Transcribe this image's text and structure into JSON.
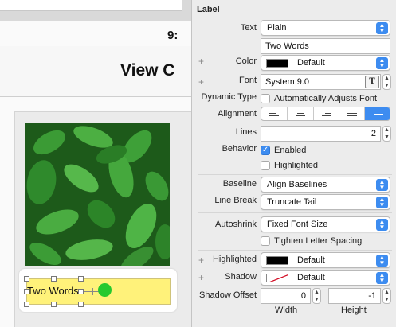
{
  "canvas": {
    "time": "9:",
    "view_title": "View C",
    "label_text": "Two Words"
  },
  "inspector": {
    "section_title": "Label",
    "text": {
      "label": "Text",
      "mode": "Plain",
      "value": "Two Words"
    },
    "color": {
      "label": "Color",
      "value": "Default",
      "swatch": "#000000"
    },
    "font": {
      "label": "Font",
      "value": "System 9.0",
      "icon": "font-T-icon"
    },
    "dynamic_type": {
      "label": "Dynamic Type",
      "checkbox": "Automatically Adjusts Font",
      "checked": false
    },
    "alignment": {
      "label": "Alignment",
      "options": [
        "left",
        "center",
        "right",
        "justified",
        "natural"
      ],
      "selected": "natural"
    },
    "lines": {
      "label": "Lines",
      "value": "2"
    },
    "behavior": {
      "label": "Behavior",
      "enabled": {
        "label": "Enabled",
        "checked": true
      },
      "highlighted": {
        "label": "Highlighted",
        "checked": false
      }
    },
    "baseline": {
      "label": "Baseline",
      "value": "Align Baselines"
    },
    "line_break": {
      "label": "Line Break",
      "value": "Truncate Tail"
    },
    "autoshrink": {
      "label": "Autoshrink",
      "value": "Fixed Font Size",
      "tighten": "Tighten Letter Spacing",
      "tighten_checked": false
    },
    "highlighted_color": {
      "label": "Highlighted",
      "value": "Default",
      "swatch": "#000000"
    },
    "shadow": {
      "label": "Shadow",
      "value": "Default"
    },
    "shadow_offset": {
      "label": "Shadow Offset",
      "width": "0",
      "height": "-1",
      "width_caption": "Width",
      "height_caption": "Height"
    }
  },
  "colors": {
    "accent": "#3d8cf0",
    "label_bg": "#fff27a",
    "dot": "#27c92f"
  }
}
